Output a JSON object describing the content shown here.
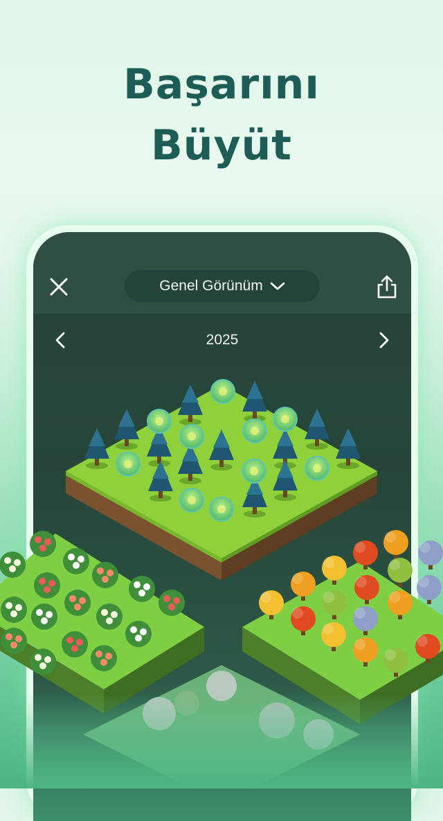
{
  "headline": {
    "line1": "Başarını",
    "line2": "Büyüt"
  },
  "app": {
    "close_icon": "close-icon",
    "view_selector": {
      "label": "Genel Görünüm",
      "icon": "chevron-down-icon"
    },
    "share_icon": "share-icon",
    "year_nav": {
      "year": "2025",
      "prev_icon": "chevron-left-icon",
      "next_icon": "chevron-right-icon"
    }
  },
  "colors": {
    "headline": "#1e5d55",
    "screen_bg": "#264538",
    "topbar_bg": "#2f4f43",
    "grass": "#8fd13a",
    "soil": "#7a5230"
  }
}
